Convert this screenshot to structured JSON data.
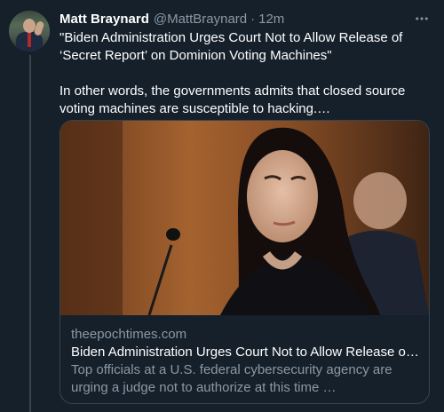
{
  "tweet": {
    "author_name": "Matt Braynard",
    "author_handle": "@MattBraynard",
    "separator": "·",
    "timestamp": "12m",
    "text_line1": "\"Biden Administration Urges Court Not to Allow Release of ‘Secret Report’ on Dominion Voting Machines\"",
    "text_line2": "In other words, the governments admits that closed source voting machines are susceptible to hacking.…"
  },
  "card": {
    "domain": "theepochtimes.com",
    "title": "Biden Administration Urges Court Not to Allow Release of ‘…",
    "description": "Top officials at a U.S. federal cybersecurity agency are urging a judge not to authorize at this time …"
  },
  "icons": {
    "more": "more-horizontal-icon"
  },
  "colors": {
    "background": "#15202b",
    "secondary_text": "#8b98a5",
    "border": "#38444d"
  }
}
